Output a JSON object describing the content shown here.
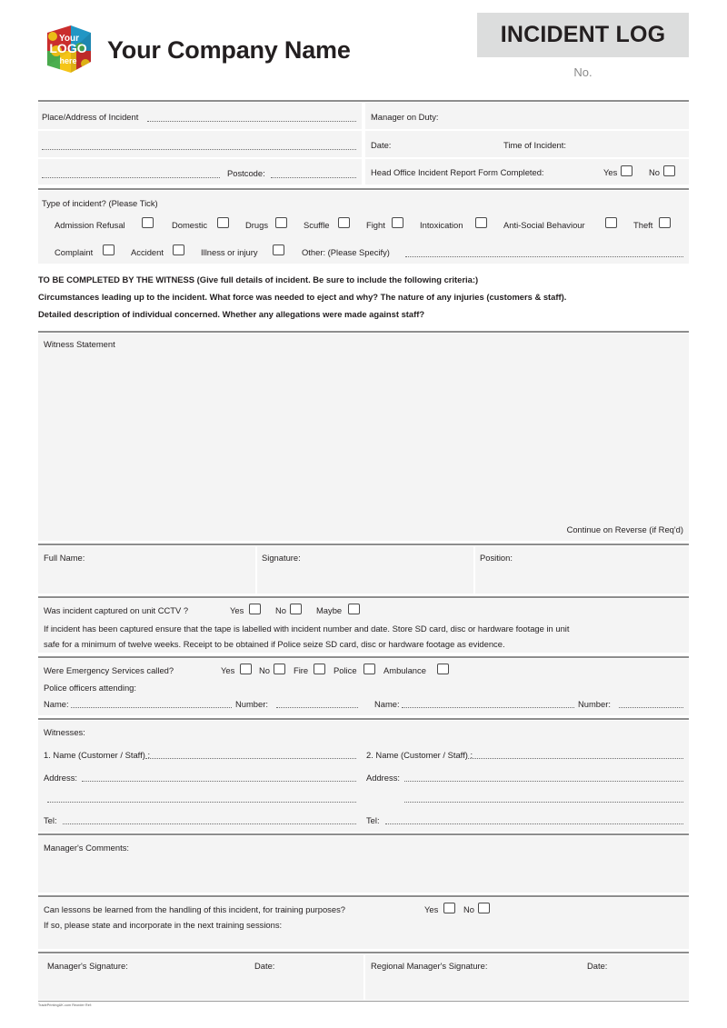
{
  "header": {
    "logo": {
      "line1": "Your",
      "line2": "LOGO",
      "line3": "here"
    },
    "company_name": "Your Company Name",
    "badge_title": "INCIDENT LOG",
    "number_label": "No.",
    "badge_bg": "#dcdddd"
  },
  "incident_details": {
    "place_label": "Place/Address of Incident",
    "postcode_label": "Postcode:",
    "manager_on_duty_label": "Manager on Duty:",
    "date_label": "Date:",
    "time_label": "Time of Incident:",
    "head_office_label": "Head Office Incident Report Form Completed:",
    "yes_label": "Yes",
    "no_label": "No"
  },
  "incident_type": {
    "heading": "Type of incident? (Please Tick)",
    "row1": [
      "Admission Refusal",
      "Domestic",
      "Drugs",
      "Scuffle",
      "Fight",
      "Intoxication",
      "Anti-Social Behaviour",
      "Theft"
    ],
    "row2": [
      "Complaint",
      "Accident",
      "Illness or injury"
    ],
    "other_label": "Other: (Please Specify)"
  },
  "witness_instructions": [
    "TO BE COMPLETED BY THE WITNESS (Give full details of incident. Be sure to include the following criteria:)",
    "Circumstances leading up to the incident. What force was needed to eject and why? The nature of any injuries (customers & staff).",
    "Detailed description of individual concerned. Whether any allegations were made against staff?"
  ],
  "witness_statement": {
    "label": "Witness Statement",
    "continue_note": "Continue on Reverse (if Req'd)"
  },
  "signature_row": {
    "full_name_label": "Full Name:",
    "signature_label": "Signature:",
    "position_label": "Position:"
  },
  "cctv": {
    "question": "Was incident captured on unit CCTV ?",
    "options": [
      "Yes",
      "No",
      "Maybe"
    ],
    "note_line1": "If incident has been captured ensure that the tape is labelled with incident number and date. Store SD card, disc or hardware footage in unit",
    "note_line2": "safe for a minimum of twelve weeks. Receipt to be obtained if Police seize SD card, disc or hardware footage as evidence."
  },
  "emergency": {
    "question": "Were Emergency Services called?",
    "options": [
      "Yes",
      "No",
      "Fire",
      "Police",
      "Ambulance"
    ],
    "police_attending_label": "Police officers attending:",
    "name_label": "Name:",
    "number_label": "Number:"
  },
  "witnesses": {
    "heading": "Witnesses:",
    "name1_label": "1. Name (Customer / Staff) :",
    "name2_label": "2. Name (Customer / Staff) :",
    "address_label": "Address:",
    "tel_label": "Tel:"
  },
  "manager_comments": {
    "label": "Manager's Comments:"
  },
  "lessons": {
    "question": "Can lessons be learned from the handling of this incident, for training purposes?",
    "yes_label": "Yes",
    "no_label": "No",
    "note": "If so, please state and incorporate in the next training sessions:"
  },
  "signoff": {
    "manager_signature_label": "Manager's Signature:",
    "manager_date_label": "Date:",
    "regional_signature_label": "Regional Manager's Signature:",
    "regional_date_label": "Date:"
  },
  "footer": {
    "micro_text": "TradePrintingUK.com Reorder Ref:"
  }
}
